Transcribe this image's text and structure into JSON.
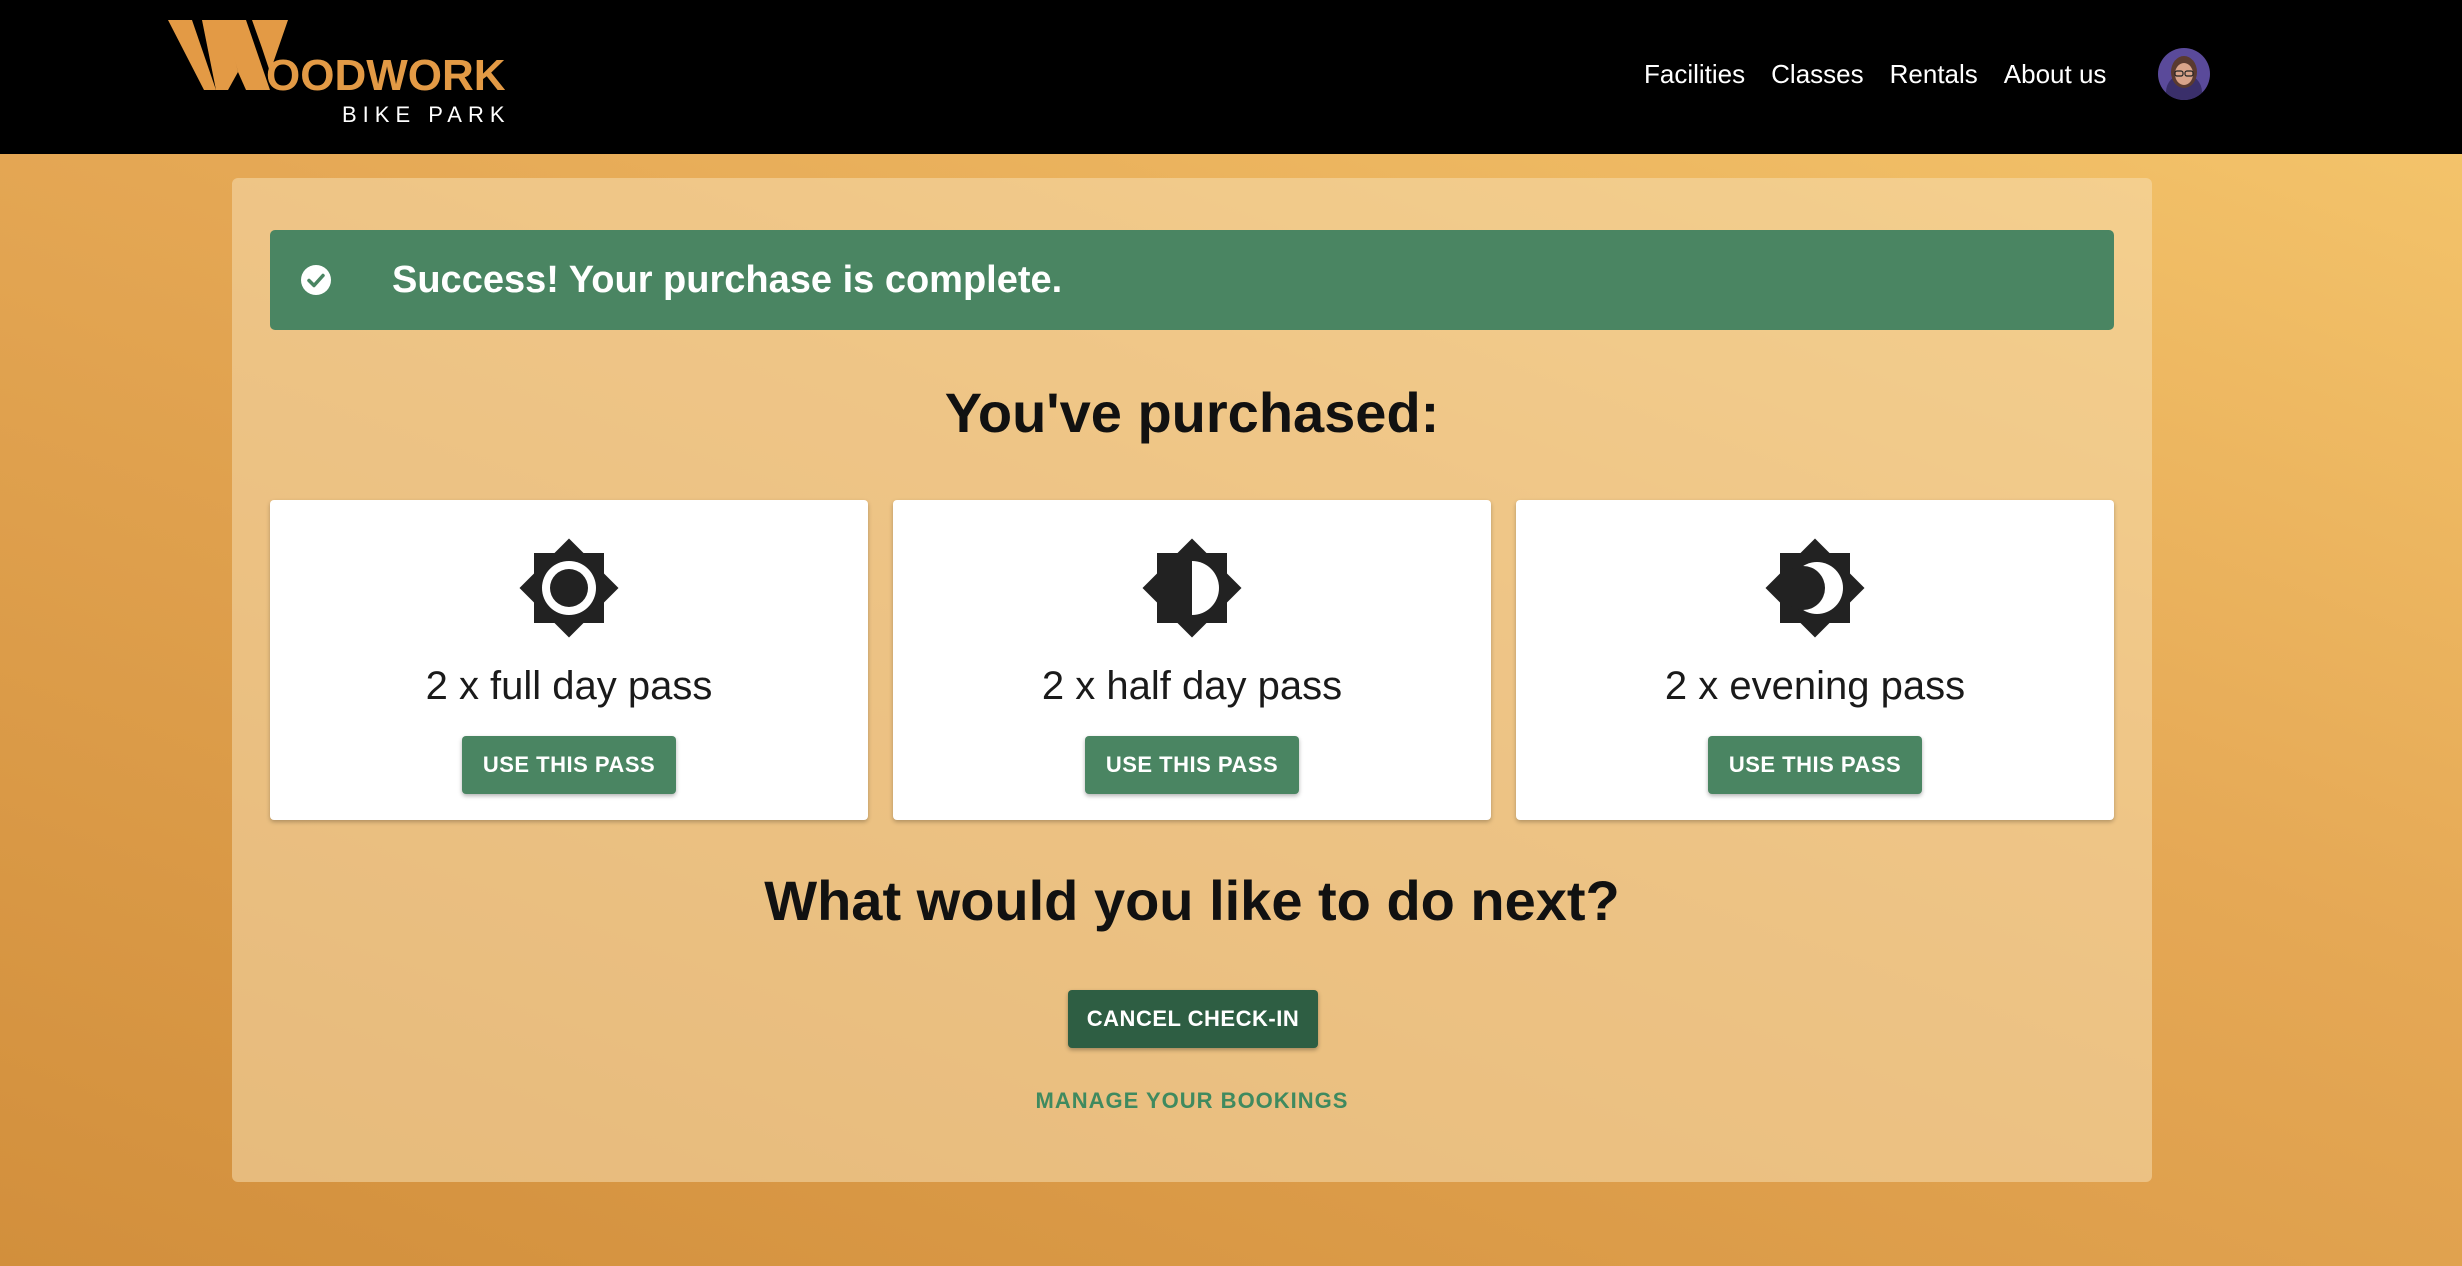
{
  "header": {
    "logo_main": "OODWORK",
    "logo_sub": "BIKE PARK",
    "nav": [
      "Facilities",
      "Classes",
      "Rentals",
      "About us"
    ]
  },
  "alert": {
    "message": "Success! Your purchase is complete.",
    "icon": "check-circle-icon",
    "color": "#4a8562"
  },
  "purchased_heading": "You've purchased:",
  "passes": [
    {
      "label": "2 x full day pass",
      "icon": "brightness-high-icon",
      "button": "USE THIS PASS"
    },
    {
      "label": "2 x half day pass",
      "icon": "brightness-medium-icon",
      "button": "USE THIS PASS"
    },
    {
      "label": "2 x evening pass",
      "icon": "brightness-night-icon",
      "button": "USE THIS PASS"
    }
  ],
  "next_heading": "What would you like to do next?",
  "actions": {
    "cancel_label": "CANCEL CHECK-IN",
    "manage_label": "MANAGE YOUR BOOKINGS"
  },
  "colors": {
    "brand_orange": "#e39a45",
    "accent_green": "#4a8562",
    "dark_green": "#2e5e43"
  }
}
